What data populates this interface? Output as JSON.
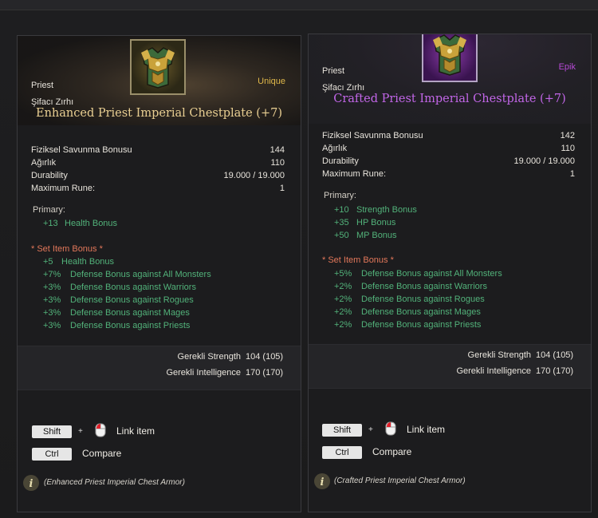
{
  "left": {
    "class": "Priest",
    "type": "Şifacı Zırhı",
    "rarity": "Unique",
    "name": "Enhanced Priest Imperial Chestplate (+7)",
    "stats": [
      {
        "label": "Fiziksel Savunma Bonusu",
        "value": "144"
      },
      {
        "label": "Ağırlık",
        "value": "110"
      },
      {
        "label": "Durability",
        "value": "19.000 / 19.000"
      },
      {
        "label": "Maximum Rune:",
        "value": "1"
      }
    ],
    "primary_title": "Primary:",
    "primary": [
      {
        "value": "+13",
        "text": "Health Bonus"
      }
    ],
    "set_title": "* Set Item  Bonus *",
    "set_bonuses": [
      {
        "value": "+5",
        "text": "Health Bonus"
      },
      {
        "value": "+7%",
        "text": "Defense Bonus against All Monsters"
      },
      {
        "value": "+3%",
        "text": "Defense Bonus against Warriors"
      },
      {
        "value": "+3%",
        "text": "Defense Bonus against Rogues"
      },
      {
        "value": "+3%",
        "text": "Defense Bonus against Mages"
      },
      {
        "value": "+3%",
        "text": "Defense Bonus against Priests"
      }
    ],
    "requirements": [
      {
        "label": "Gerekli Strength",
        "value": "104 (105)"
      },
      {
        "label": "Gerekli Intelligence",
        "value": "170 (170)"
      }
    ],
    "footer": "(Enhanced Priest Imperial Chest Armor)"
  },
  "right": {
    "class": "Priest",
    "type": "Şifacı Zırhı",
    "rarity": "Epik",
    "name": "Crafted Priest Imperial Chestplate (+7)",
    "stats": [
      {
        "label": "Fiziksel Savunma Bonusu",
        "value": "142"
      },
      {
        "label": "Ağırlık",
        "value": "110"
      },
      {
        "label": "Durability",
        "value": "19.000 / 19.000"
      },
      {
        "label": "Maximum Rune:",
        "value": "1"
      }
    ],
    "primary_title": "Primary:",
    "primary": [
      {
        "value": "+10",
        "text": "Strength Bonus"
      },
      {
        "value": "+35",
        "text": "HP Bonus"
      },
      {
        "value": "+50",
        "text": "MP Bonus"
      }
    ],
    "set_title": "* Set Item  Bonus *",
    "set_bonuses": [
      {
        "value": "+5%",
        "text": "Defense Bonus against All Monsters"
      },
      {
        "value": "+2%",
        "text": "Defense Bonus against Warriors"
      },
      {
        "value": "+2%",
        "text": "Defense Bonus against Rogues"
      },
      {
        "value": "+2%",
        "text": "Defense Bonus against Mages"
      },
      {
        "value": "+2%",
        "text": "Defense Bonus against Priests"
      }
    ],
    "requirements": [
      {
        "label": "Gerekli Strength",
        "value": "104 (105)"
      },
      {
        "label": "Gerekli Intelligence",
        "value": "170 (170)"
      }
    ],
    "footer": "(Crafted Priest Imperial Chest Armor)"
  },
  "hints": {
    "shift_key": "Shift",
    "plus": "+",
    "link_item": "Link item",
    "ctrl_key": "Ctrl",
    "compare": "Compare"
  },
  "icons": {
    "item_icon": "chestplate-icon",
    "mouse_icon": "mouse-icon",
    "info_icon": "info-icon"
  },
  "colors": {
    "unique": "#e0b84a",
    "epic": "#b64ad6",
    "name_unique": "#e9cf92",
    "name_epic": "#c266e8",
    "bonus_green": "#52b27a",
    "set_title": "#e2775a",
    "background": "#1c1c1e"
  }
}
